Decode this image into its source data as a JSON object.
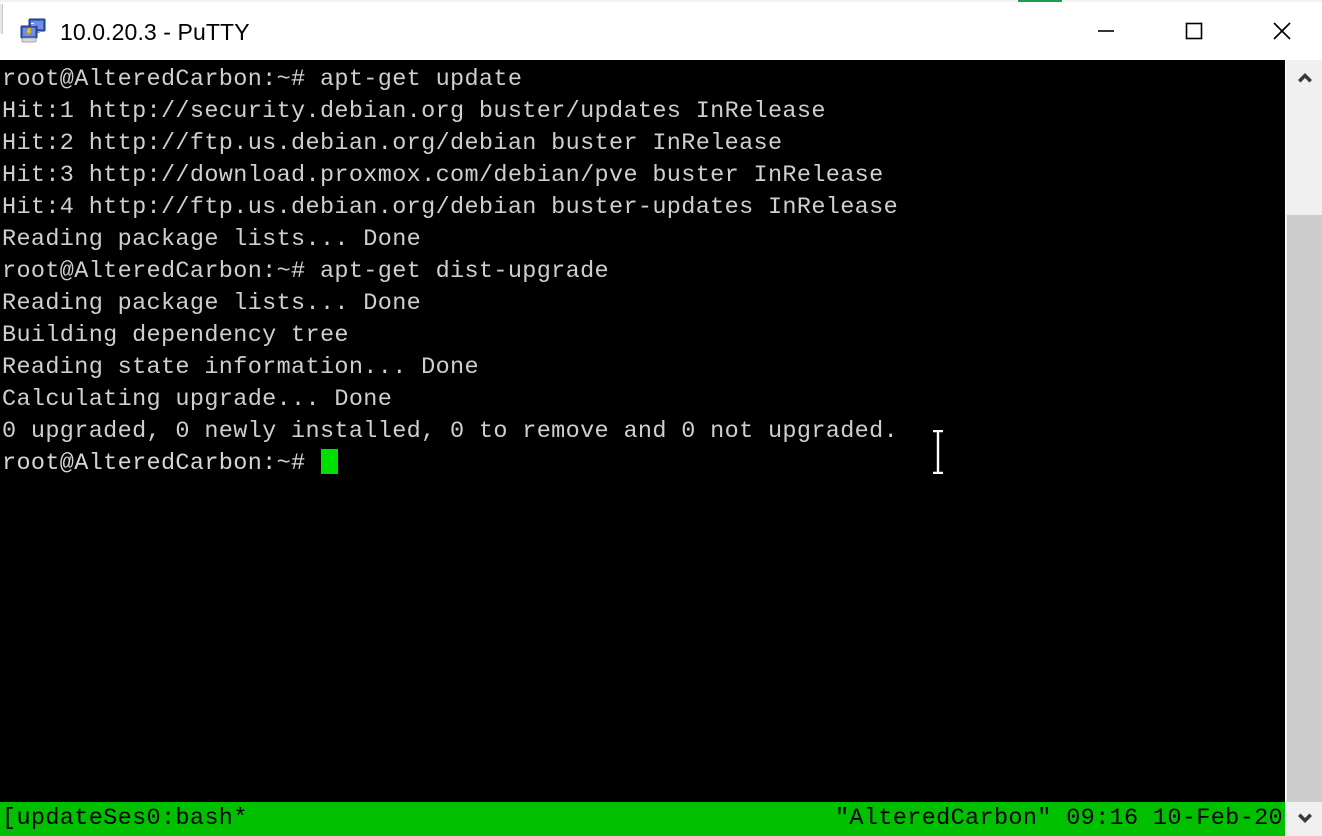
{
  "window": {
    "title": "10.0.20.3 - PuTTY",
    "icon": "putty-icon",
    "controls": {
      "minimize_label": "Minimize",
      "maximize_label": "Maximize",
      "close_label": "Close"
    }
  },
  "terminal": {
    "background_color": "#000000",
    "foreground_color": "#cfcfcf",
    "cursor_color": "#00e000",
    "lines": [
      "root@AlteredCarbon:~# apt-get update",
      "Hit:1 http://security.debian.org buster/updates InRelease",
      "Hit:2 http://ftp.us.debian.org/debian buster InRelease",
      "Hit:3 http://download.proxmox.com/debian/pve buster InRelease",
      "Hit:4 http://ftp.us.debian.org/debian buster-updates InRelease",
      "Reading package lists... Done",
      "root@AlteredCarbon:~# apt-get dist-upgrade",
      "Reading package lists... Done",
      "Building dependency tree",
      "Reading state information... Done",
      "Calculating upgrade... Done",
      "0 upgraded, 0 newly installed, 0 to remove and 0 not upgraded."
    ],
    "prompt": "root@AlteredCarbon:~# "
  },
  "status_bar": {
    "background_color": "#00c000",
    "text_color": "#000000",
    "left": "[updateSes0:bash*",
    "right": "\"AlteredCarbon\" 09:16 10-Feb-20"
  },
  "scrollbar": {
    "up_arrow": "chevron-up-icon",
    "down_arrow": "chevron-down-icon",
    "track_color": "#f0f0f0",
    "thumb_color": "#cdcdcd"
  }
}
